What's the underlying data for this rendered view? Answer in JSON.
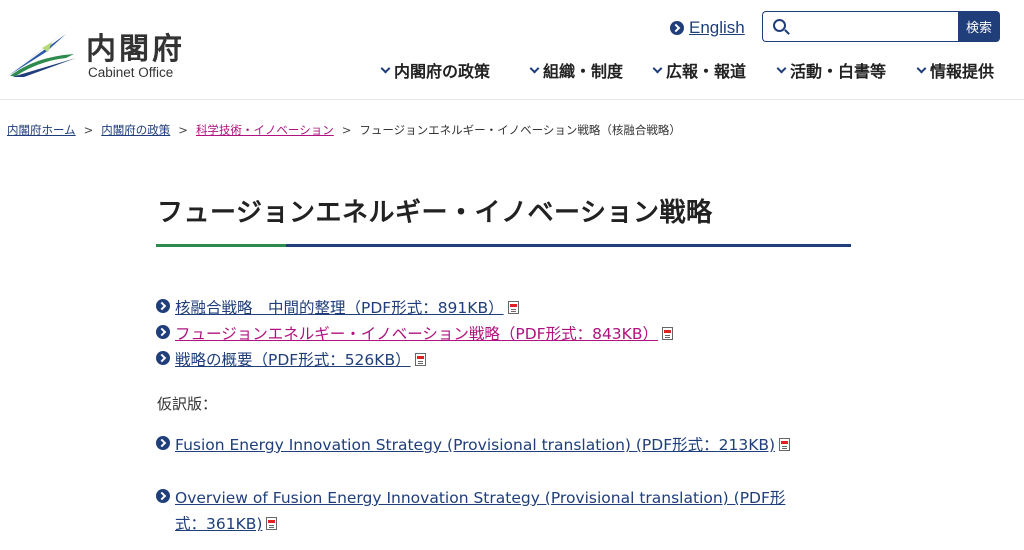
{
  "header": {
    "logo_ja": "内閣府",
    "logo_en": "Cabinet Office",
    "english_label": "English",
    "search_button": "検索",
    "search_placeholder": ""
  },
  "gnav": [
    {
      "label": "内閣府の政策"
    },
    {
      "label": "組織・制度"
    },
    {
      "label": "広報・報道"
    },
    {
      "label": "活動・白書等"
    },
    {
      "label": "情報提供"
    }
  ],
  "breadcrumb": [
    {
      "label": "内閣府ホーム"
    },
    {
      "label": "内閣府の政策"
    },
    {
      "label": "科学技術・イノベーション"
    },
    {
      "label": "フュージョンエネルギー・イノベーション戦略（核融合戦略）"
    }
  ],
  "breadcrumb_separator": ">",
  "page_title": "フュージョンエネルギー・イノベーション戦略",
  "links": [
    {
      "label": "核融合戦略　中間的整理（PDF形式：891KB）"
    },
    {
      "label": "フュージョンエネルギー・イノベーション戦略（PDF形式：843KB）"
    },
    {
      "label": "戦略の概要（PDF形式：526KB）"
    }
  ],
  "provisional_note": "仮訳版：",
  "translation_links": [
    {
      "label": "Fusion Energy Innovation Strategy (Provisional translation) (PDF形式：213KB)"
    },
    {
      "label": "Overview of Fusion Energy Innovation Strategy (Provisional translation) (PDF形式：361KB)"
    }
  ],
  "colors": {
    "brand_navy": "#1f3e7a",
    "accent_green": "#2e8b4e",
    "visited_link": "#b0127f"
  },
  "icons": [
    "cabinet-office-logo-icon",
    "circle-arrow-icon",
    "search-icon",
    "chevron-down-icon",
    "pdf-file-icon"
  ]
}
